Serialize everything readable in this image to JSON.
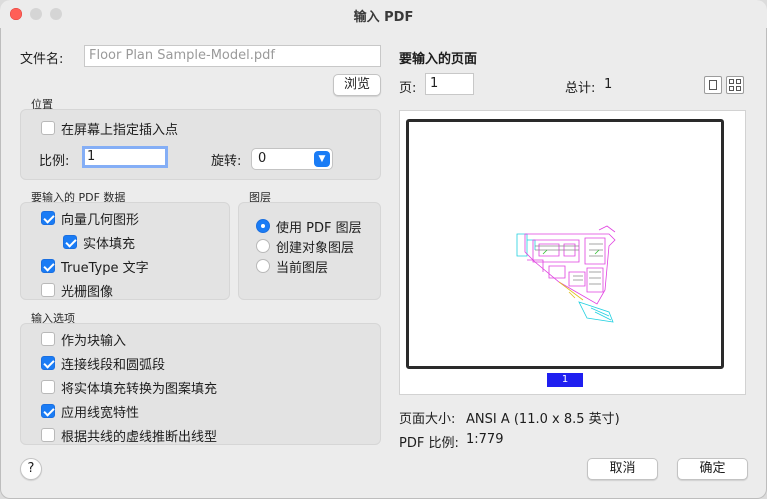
{
  "window": {
    "title": "输入 PDF"
  },
  "file": {
    "label": "文件名:",
    "value": "Floor Plan Sample-Model.pdf",
    "browse_label": "浏览"
  },
  "position_group": {
    "title": "位置",
    "specify_on_screen": {
      "label": "在屏幕上指定插入点",
      "checked": false
    },
    "scale_label": "比例:",
    "scale_value": "1",
    "rotation_label": "旋转:",
    "rotation_value": "0"
  },
  "pdf_data_group": {
    "title": "要输入的 PDF 数据",
    "items": [
      {
        "label": "向量几何图形",
        "checked": true
      },
      {
        "label": "实体填充",
        "checked": true
      },
      {
        "label": "TrueType 文字",
        "checked": true
      },
      {
        "label": "光栅图像",
        "checked": false
      }
    ]
  },
  "layers_group": {
    "title": "图层",
    "options": [
      {
        "label": "使用 PDF 图层",
        "selected": true
      },
      {
        "label": "创建对象图层",
        "selected": false
      },
      {
        "label": "当前图层",
        "selected": false
      }
    ]
  },
  "import_options_group": {
    "title": "输入选项",
    "items": [
      {
        "label": "作为块输入",
        "checked": false
      },
      {
        "label": "连接线段和圆弧段",
        "checked": true
      },
      {
        "label": "将实体填充转换为图案填充",
        "checked": false
      },
      {
        "label": "应用线宽特性",
        "checked": true
      },
      {
        "label": "根据共线的虚线推断出线型",
        "checked": false
      }
    ]
  },
  "pages": {
    "title": "要输入的页面",
    "page_label": "页:",
    "page_value": "1",
    "total_label": "总计:",
    "total_value": "1",
    "thumbnail_page_number": "1",
    "view_icons": [
      "single-page-view-icon",
      "grid-view-icon"
    ]
  },
  "page_info": {
    "size_label": "页面大小:",
    "size_value": "ANSI A (11.0 x 8.5 英寸)",
    "scale_label": "PDF 比例:",
    "scale_value": "1:779"
  },
  "buttons": {
    "help": "?",
    "cancel": "取消",
    "ok": "确定"
  },
  "colors": {
    "accent": "#1a7cf5",
    "close": "#ff5f57",
    "page_badge": "#1f1ff0",
    "drawing_magenta": "#e040e0",
    "drawing_cyan": "#20d0e0"
  }
}
